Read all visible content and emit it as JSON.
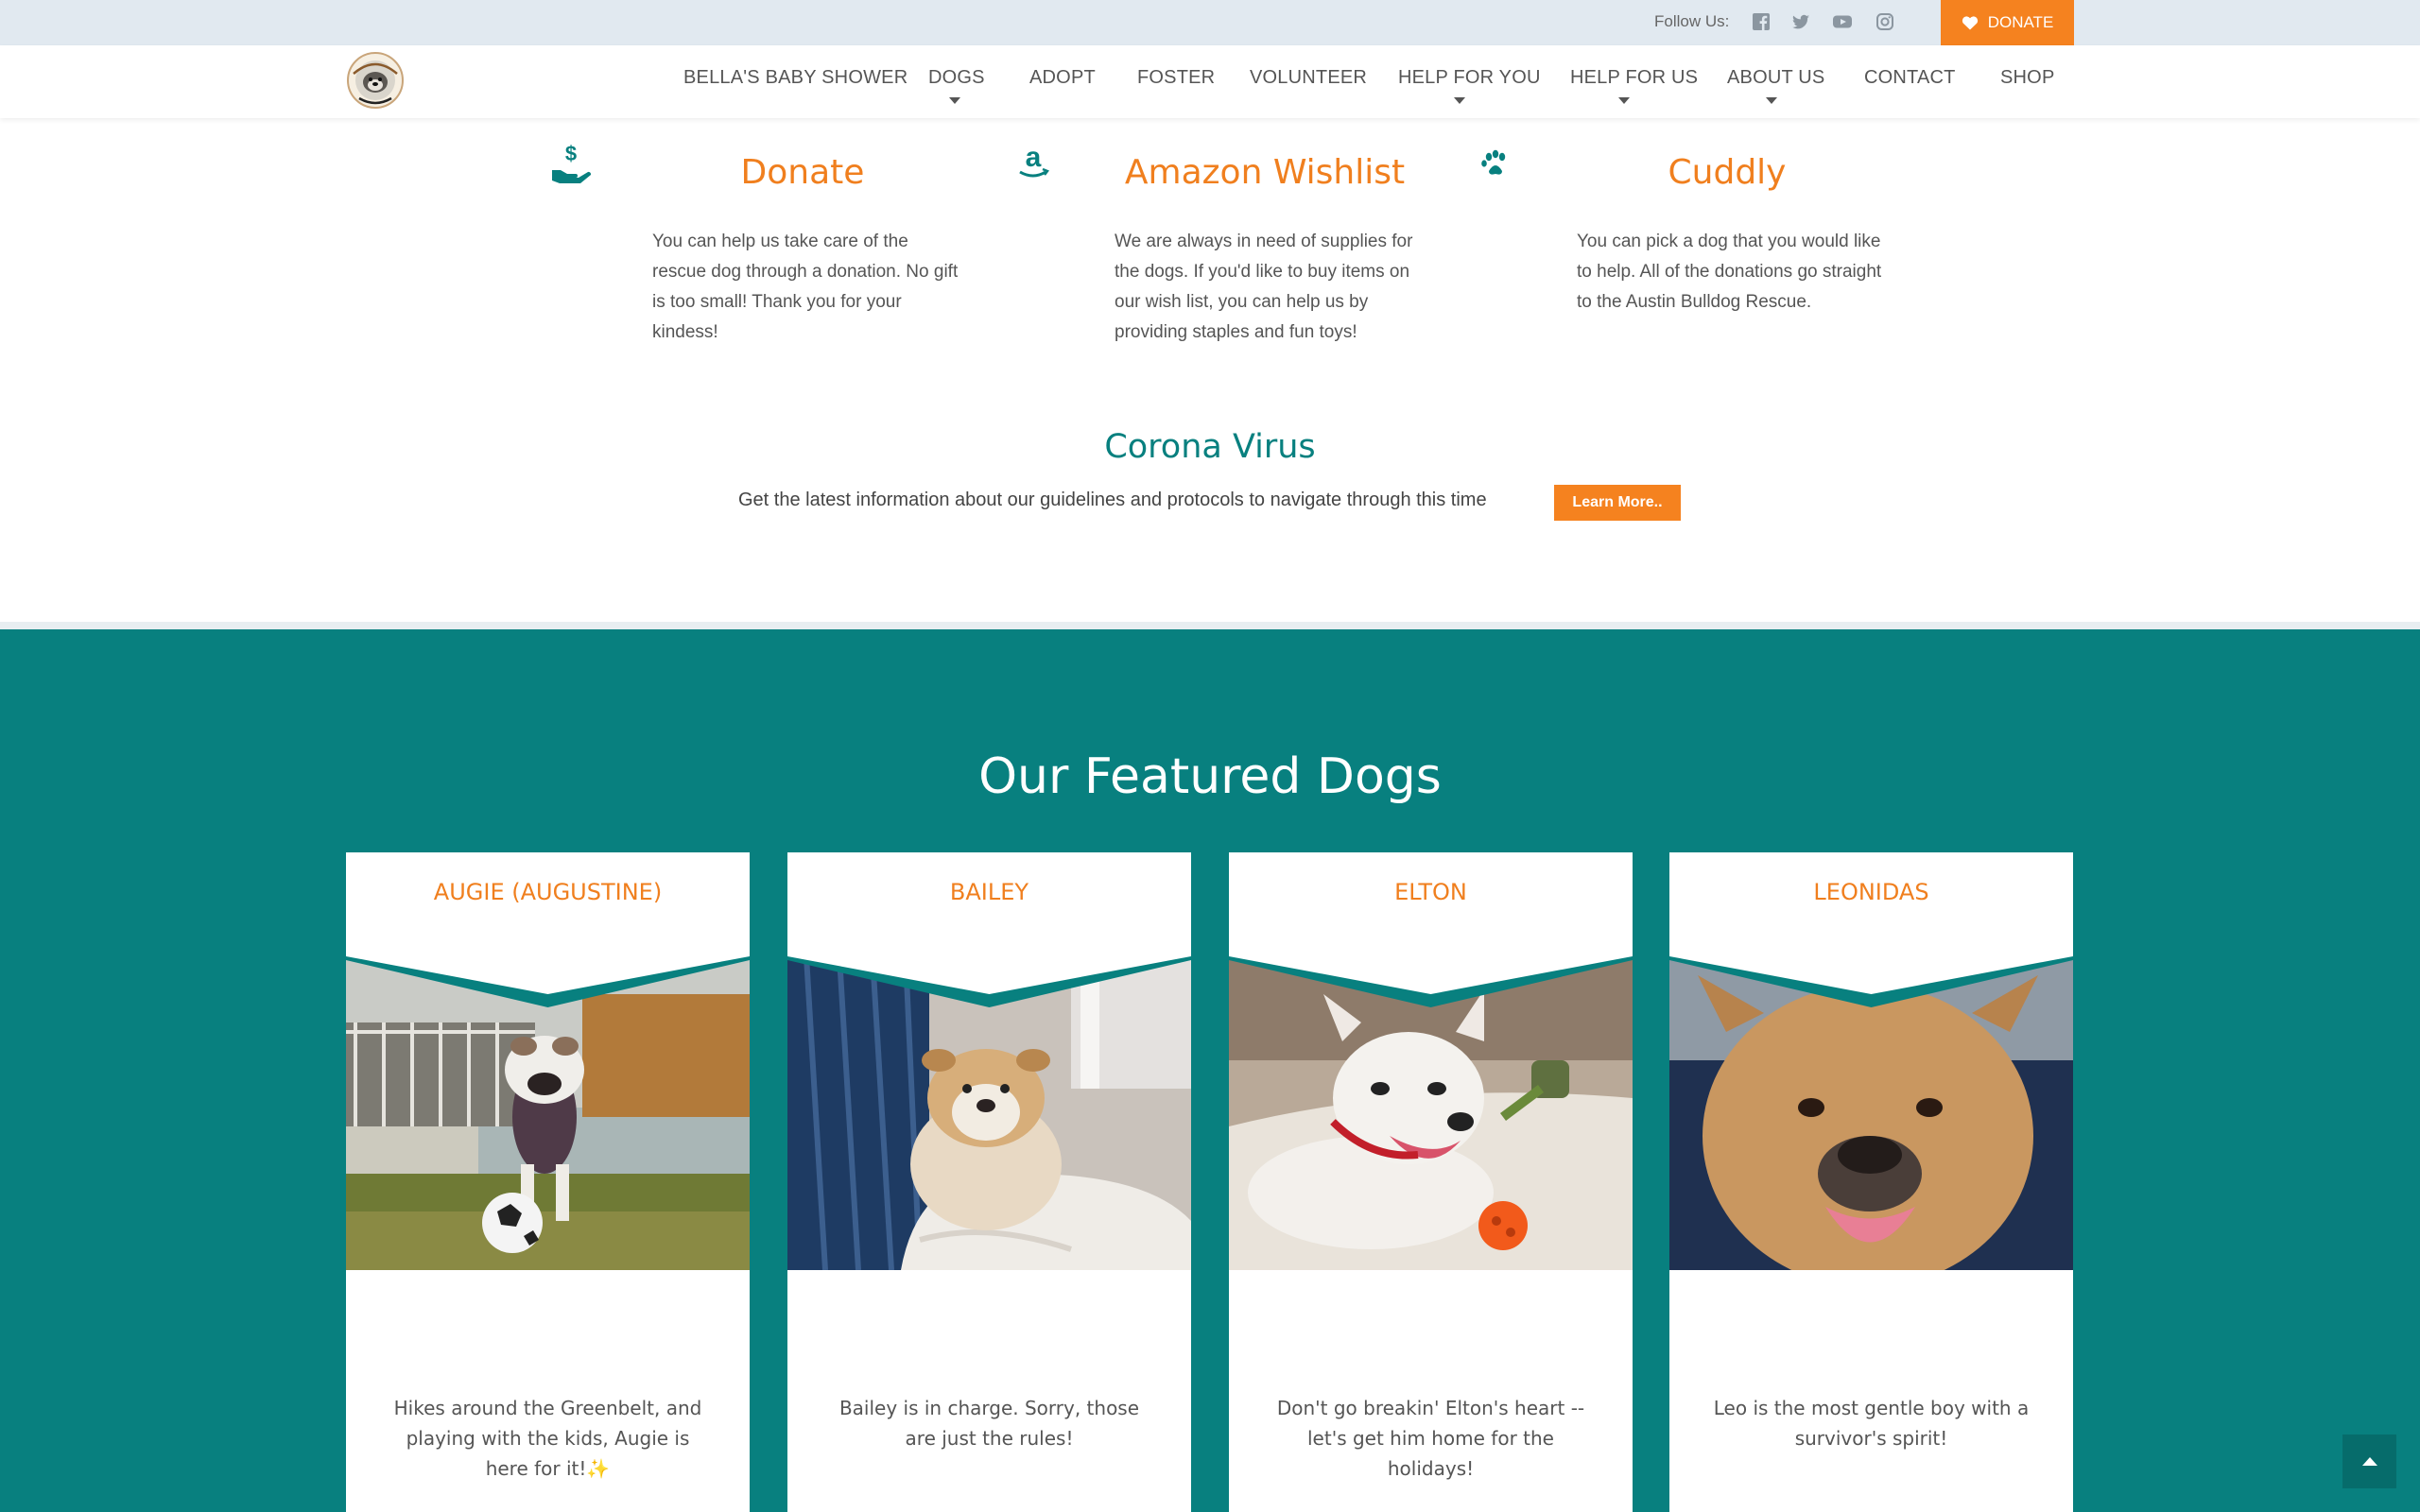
{
  "topbar": {
    "follow_label": "Follow Us:",
    "social_icons": [
      "facebook-icon",
      "twitter-icon",
      "youtube-icon",
      "instagram-icon"
    ],
    "donate_label": "DONATE"
  },
  "nav": {
    "items": [
      {
        "label": "BELLA'S BABY SHOWER",
        "dropdown": false
      },
      {
        "label": "DOGS",
        "dropdown": true
      },
      {
        "label": "ADOPT",
        "dropdown": false
      },
      {
        "label": "FOSTER",
        "dropdown": false
      },
      {
        "label": "VOLUNTEER",
        "dropdown": false
      },
      {
        "label": "HELP FOR YOU",
        "dropdown": true
      },
      {
        "label": "HELP FOR US",
        "dropdown": true
      },
      {
        "label": "ABOUT US",
        "dropdown": true
      },
      {
        "label": "CONTACT",
        "dropdown": false
      },
      {
        "label": "SHOP",
        "dropdown": false
      }
    ]
  },
  "help": [
    {
      "icon": "hand-dollar-icon",
      "title": "Donate",
      "text": "You can help us take care of the rescue dog through a donation. No gift is too small! Thank you for your kindess!"
    },
    {
      "icon": "amazon-icon",
      "title": "Amazon Wishlist",
      "text": "We are always in need of supplies for the dogs. If you'd like to buy items on our wish list, you can help us by providing staples and fun toys!"
    },
    {
      "icon": "paw-icon",
      "title": "Cuddly",
      "text": "You can pick a dog that you would like to help. All of the donations go straight to the Austin Bulldog Rescue."
    }
  ],
  "corona": {
    "title": "Corona Virus",
    "text": "Get the latest information about our guidelines and protocols to navigate through this time",
    "button": "Learn More.."
  },
  "featured": {
    "title": "Our Featured Dogs",
    "dogs": [
      {
        "name": "AUGIE (AUGUSTINE)",
        "desc": "Hikes around the Greenbelt, and playing with the kids, Augie is here for it!✨"
      },
      {
        "name": "BAILEY",
        "desc": "Bailey is in charge. Sorry, those are just the rules!"
      },
      {
        "name": "ELTON",
        "desc": "Don't go breakin' Elton's heart -- let's get him home for the holidays!"
      },
      {
        "name": "LEONIDAS",
        "desc": "Leo is the most gentle boy with a survivor's spirit!"
      }
    ]
  },
  "colors": {
    "teal": "#08807f",
    "orange": "#f5821f",
    "topbar": "#e1e9f0"
  }
}
